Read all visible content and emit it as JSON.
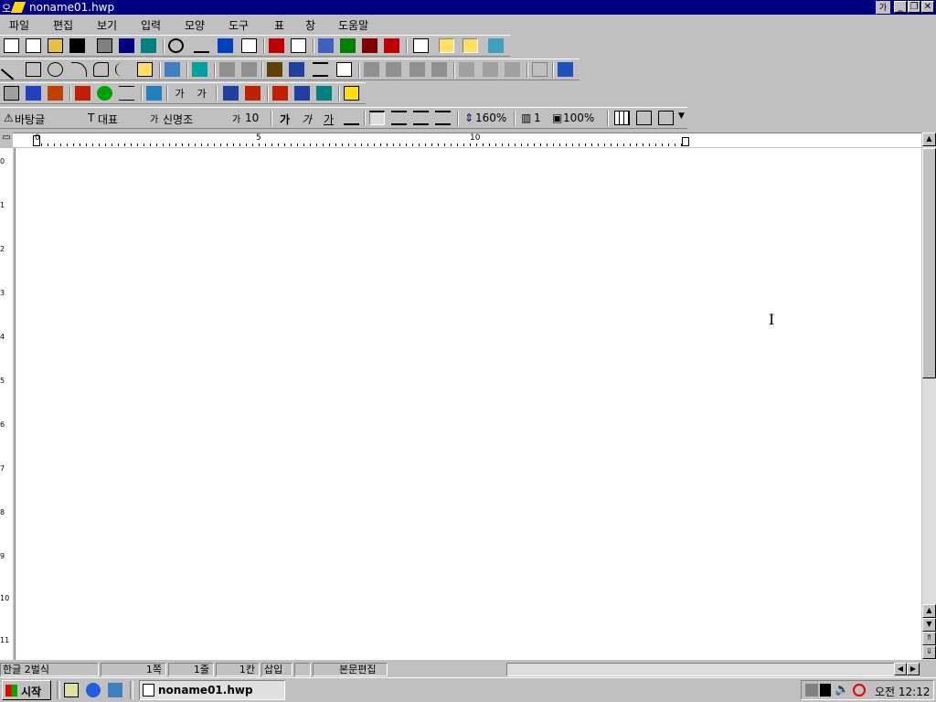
{
  "window": {
    "title": "noname01.hwp",
    "app_icon": "hwp-app-icon"
  },
  "menu": [
    "파일",
    "편집",
    "보기",
    "입력",
    "모양",
    "도구",
    "표",
    "창",
    "도움말"
  ],
  "format_bar": {
    "style": "바탕글",
    "font_class": "대표",
    "font_name": "신명조",
    "font_size": "10",
    "bold": "가",
    "italic": "가",
    "underline": "가",
    "line_spacing": "160%",
    "columns": "1",
    "zoom": "100%"
  },
  "ruler": {
    "marks": [
      "0",
      "5",
      "10"
    ],
    "vertical_marks": [
      "0",
      "1",
      "2",
      "3",
      "4",
      "5",
      "6",
      "7",
      "8",
      "9",
      "10",
      "11"
    ]
  },
  "status": {
    "input_mode": "한글 2벌식",
    "page": "1쪽",
    "line": "1줄",
    "column": "1칸",
    "insert_mode": "삽입",
    "edit_mode": "본문편집"
  },
  "taskbar": {
    "start_label": "시작",
    "task_label": "noname01.hwp",
    "clock": "오전 12:12"
  }
}
